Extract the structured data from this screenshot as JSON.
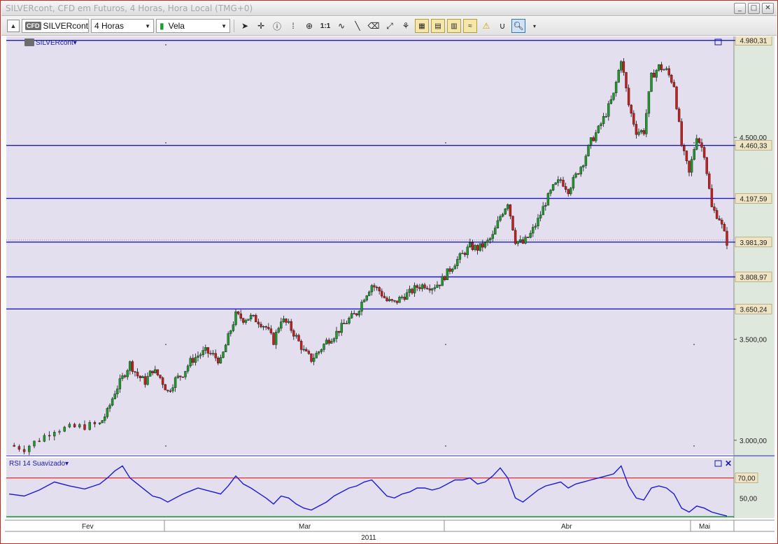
{
  "window": {
    "title": "SILVERcont, CFD em Futuros, 4 Horas, Hora Local (TMG+0)"
  },
  "toolbar": {
    "symbol": "SILVERcont",
    "symbol_badge": "CFD",
    "timeframe": "4 Horas",
    "chart_style": "Vela",
    "zoom_ratio_label": "1:1",
    "icons": [
      "pointer-icon",
      "crosshair-icon",
      "info-icon",
      "grid-icon",
      "zoom-icon",
      "indicator-icon",
      "line-tool-icon",
      "eraser-icon",
      "fibonacci-icon",
      "levels-icon",
      "template-icons",
      "alert-icon",
      "magnet-icon",
      "search-zoom-icon"
    ]
  },
  "chart": {
    "instrument_label": "SILVERcont",
    "bg_color": "#e4dfee",
    "up_color": "#1e9b2d",
    "down_color": "#c81e1e",
    "line_color": "#1a1ad6"
  },
  "chart_data": {
    "type": "line",
    "title": "SILVERcont, CFD em Futuros, 4 Horas, Hora Local (TMG+0)",
    "xlabel": "",
    "ylabel": "",
    "ylim": [
      2930,
      5000
    ],
    "price_ticks": [
      "3.000,00",
      "3.500,00",
      "4.500,00"
    ],
    "price_tick_values": [
      3000,
      3500,
      4500
    ],
    "horizontal_levels": [
      {
        "value": 4980.31,
        "label": "4.980,31"
      },
      {
        "value": 4460.33,
        "label": "4.460,33"
      },
      {
        "value": 4197.59,
        "label": "4.197,59"
      },
      {
        "value": 3981.39,
        "label": "3.981,39"
      },
      {
        "value": 3808.97,
        "label": "3.808,97"
      },
      {
        "value": 3650.24,
        "label": "3.650,24"
      }
    ],
    "months": [
      "Fev",
      "Mar",
      "Abr",
      "Mai"
    ],
    "year": "2011",
    "price_path": [
      [
        0,
        2975
      ],
      [
        2,
        2960
      ],
      [
        4,
        3005
      ],
      [
        6,
        3055
      ],
      [
        8,
        3060
      ],
      [
        10,
        3070
      ],
      [
        12,
        3080
      ],
      [
        13,
        3140
      ],
      [
        14,
        3240
      ],
      [
        15,
        3310
      ],
      [
        16,
        3380
      ],
      [
        17,
        3320
      ],
      [
        18,
        3290
      ],
      [
        19,
        3350
      ],
      [
        20,
        3310
      ],
      [
        21,
        3240
      ],
      [
        22,
        3300
      ],
      [
        23,
        3330
      ],
      [
        24,
        3390
      ],
      [
        25,
        3420
      ],
      [
        26,
        3440
      ],
      [
        27,
        3420
      ],
      [
        28,
        3390
      ],
      [
        29,
        3510
      ],
      [
        30,
        3620
      ],
      [
        31,
        3600
      ],
      [
        32,
        3610
      ],
      [
        33,
        3590
      ],
      [
        34,
        3560
      ],
      [
        35,
        3490
      ],
      [
        36,
        3600
      ],
      [
        37,
        3570
      ],
      [
        38,
        3510
      ],
      [
        39,
        3440
      ],
      [
        40,
        3400
      ],
      [
        41,
        3440
      ],
      [
        42,
        3490
      ],
      [
        43,
        3520
      ],
      [
        44,
        3560
      ],
      [
        45,
        3600
      ],
      [
        46,
        3630
      ],
      [
        47,
        3710
      ],
      [
        48,
        3770
      ],
      [
        49,
        3740
      ],
      [
        50,
        3690
      ],
      [
        51,
        3680
      ],
      [
        52,
        3710
      ],
      [
        53,
        3730
      ],
      [
        54,
        3760
      ],
      [
        55,
        3770
      ],
      [
        56,
        3760
      ],
      [
        57,
        3780
      ],
      [
        58,
        3830
      ],
      [
        59,
        3880
      ],
      [
        60,
        3920
      ],
      [
        61,
        3960
      ],
      [
        62,
        3950
      ],
      [
        63,
        3970
      ],
      [
        64,
        4010
      ],
      [
        65,
        4110
      ],
      [
        66,
        4180
      ],
      [
        67,
        3990
      ],
      [
        68,
        3975
      ],
      [
        69,
        4020
      ],
      [
        70,
        4090
      ],
      [
        71,
        4180
      ],
      [
        72,
        4250
      ],
      [
        73,
        4290
      ],
      [
        74,
        4240
      ],
      [
        75,
        4310
      ],
      [
        76,
        4380
      ],
      [
        77,
        4480
      ],
      [
        78,
        4540
      ],
      [
        79,
        4620
      ],
      [
        80,
        4710
      ],
      [
        81,
        4890
      ],
      [
        82,
        4660
      ],
      [
        83,
        4530
      ],
      [
        84,
        4530
      ],
      [
        85,
        4800
      ],
      [
        86,
        4850
      ],
      [
        87,
        4830
      ],
      [
        88,
        4760
      ],
      [
        89,
        4460
      ],
      [
        90,
        4320
      ],
      [
        91,
        4510
      ],
      [
        92,
        4420
      ],
      [
        93,
        4150
      ],
      [
        94,
        4100
      ],
      [
        95,
        3981
      ]
    ],
    "rsi": {
      "name": "RSI 14 Suavizado",
      "ylim": [
        30,
        90
      ],
      "levels": [
        {
          "value": 70,
          "label": "70,00"
        }
      ],
      "tick_labels": [
        "50,00"
      ],
      "values": [
        [
          0,
          54
        ],
        [
          2,
          52
        ],
        [
          4,
          58
        ],
        [
          6,
          66
        ],
        [
          8,
          62
        ],
        [
          10,
          59
        ],
        [
          12,
          64
        ],
        [
          13,
          70
        ],
        [
          14,
          77
        ],
        [
          15,
          82
        ],
        [
          16,
          70
        ],
        [
          17,
          64
        ],
        [
          18,
          58
        ],
        [
          19,
          52
        ],
        [
          20,
          50
        ],
        [
          21,
          46
        ],
        [
          22,
          50
        ],
        [
          23,
          54
        ],
        [
          24,
          57
        ],
        [
          25,
          60
        ],
        [
          26,
          58
        ],
        [
          27,
          56
        ],
        [
          28,
          54
        ],
        [
          29,
          62
        ],
        [
          30,
          72
        ],
        [
          31,
          64
        ],
        [
          32,
          60
        ],
        [
          33,
          55
        ],
        [
          34,
          50
        ],
        [
          35,
          44
        ],
        [
          36,
          52
        ],
        [
          37,
          50
        ],
        [
          38,
          44
        ],
        [
          39,
          40
        ],
        [
          40,
          38
        ],
        [
          41,
          42
        ],
        [
          42,
          46
        ],
        [
          43,
          52
        ],
        [
          44,
          56
        ],
        [
          45,
          60
        ],
        [
          46,
          62
        ],
        [
          47,
          66
        ],
        [
          48,
          68
        ],
        [
          49,
          60
        ],
        [
          50,
          52
        ],
        [
          51,
          50
        ],
        [
          52,
          54
        ],
        [
          53,
          56
        ],
        [
          54,
          60
        ],
        [
          55,
          60
        ],
        [
          56,
          58
        ],
        [
          57,
          60
        ],
        [
          58,
          64
        ],
        [
          59,
          68
        ],
        [
          60,
          68
        ],
        [
          61,
          70
        ],
        [
          62,
          64
        ],
        [
          63,
          66
        ],
        [
          64,
          72
        ],
        [
          65,
          80
        ],
        [
          66,
          70
        ],
        [
          67,
          50
        ],
        [
          68,
          46
        ],
        [
          69,
          52
        ],
        [
          70,
          58
        ],
        [
          71,
          62
        ],
        [
          72,
          64
        ],
        [
          73,
          66
        ],
        [
          74,
          60
        ],
        [
          75,
          64
        ],
        [
          76,
          66
        ],
        [
          77,
          68
        ],
        [
          78,
          70
        ],
        [
          79,
          72
        ],
        [
          80,
          74
        ],
        [
          81,
          82
        ],
        [
          82,
          62
        ],
        [
          83,
          50
        ],
        [
          84,
          48
        ],
        [
          85,
          60
        ],
        [
          86,
          62
        ],
        [
          87,
          60
        ],
        [
          88,
          54
        ],
        [
          89,
          40
        ],
        [
          90,
          36
        ],
        [
          91,
          42
        ],
        [
          92,
          40
        ],
        [
          93,
          36
        ],
        [
          94,
          34
        ],
        [
          95,
          32
        ]
      ]
    }
  }
}
